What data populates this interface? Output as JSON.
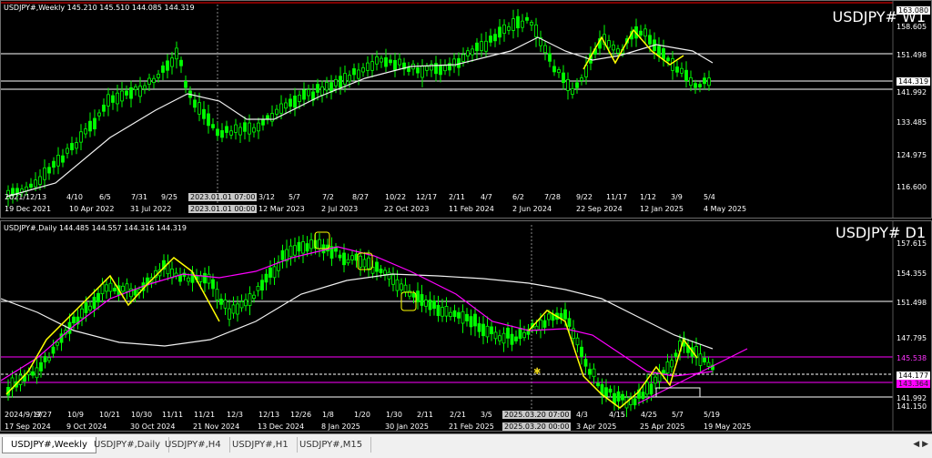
{
  "weekly": {
    "header": "USDJPY#,Weekly  145.210 145.510 144.085 144.319",
    "label": "USDJPY# W1",
    "price_ticks": [
      "163.080",
      "158.605",
      "151.498",
      "144.319",
      "141.992",
      "133.485",
      "124.975",
      "116.600"
    ],
    "time_ticks": [
      "19 Dec 2021",
      "10 Apr 2022",
      "31 Jul 2022",
      "2023.01.01 00:00",
      "12 Mar 2023",
      "2 Jul 2023",
      "22 Oct 2023",
      "11 Feb 2024",
      "2 Jun 2024",
      "22 Sep 2024",
      "12 Jan 2025",
      "4 May 2025"
    ],
    "date_marks": [
      "2021/12/13",
      "4/10",
      "6/5",
      "7/31",
      "9/25",
      "2023.01.01 07:00",
      "3/12",
      "5/7",
      "7/2",
      "8/27",
      "10/22",
      "12/17",
      "2/11",
      "4/7",
      "6/2",
      "7/28",
      "9/22",
      "11/17",
      "1/12",
      "3/9",
      "5/4"
    ]
  },
  "daily": {
    "header": "USDJPY#,Daily  144.485 144.557 144.316 144.319",
    "label": "USDJPY# D1",
    "price_ticks": [
      "157.615",
      "154.355",
      "151.498",
      "147.795",
      "145.538",
      "144.177",
      "143.364",
      "141.992",
      "141.150"
    ],
    "time_ticks": [
      "17 Sep 2024",
      "9 Oct 2024",
      "30 Oct 2024",
      "21 Nov 2024",
      "13 Dec 2024",
      "8 Jan 2025",
      "30 Jan 2025",
      "21 Feb 2025",
      "2025.03.20 00:00",
      "3 Apr 2025",
      "25 Apr 2025",
      "19 May 2025"
    ],
    "date_marks": [
      "2024/9/17",
      "9/27",
      "10/9",
      "10/21",
      "10/30",
      "11/11",
      "11/21",
      "12/3",
      "12/13",
      "12/26",
      "1/8",
      "1/20",
      "1/30",
      "2/11",
      "2/21",
      "3/5",
      "2025.03.20 07:00",
      "4/3",
      "4/15",
      "4/25",
      "5/7",
      "5/19"
    ]
  },
  "tabs": [
    "USDJPY#,Weekly",
    "USDJPY#,Daily",
    "USDJPY#,H4",
    "USDJPY#,H1",
    "USDJPY#,M15"
  ],
  "scroll_arrows": "◀ ▶",
  "colors": {
    "candle": "#00ff00",
    "ma_white": "#f0f0f0",
    "ma_magenta": "#ff00ff",
    "zigzag": "#ffff00",
    "red_line": "#ff0000"
  }
}
